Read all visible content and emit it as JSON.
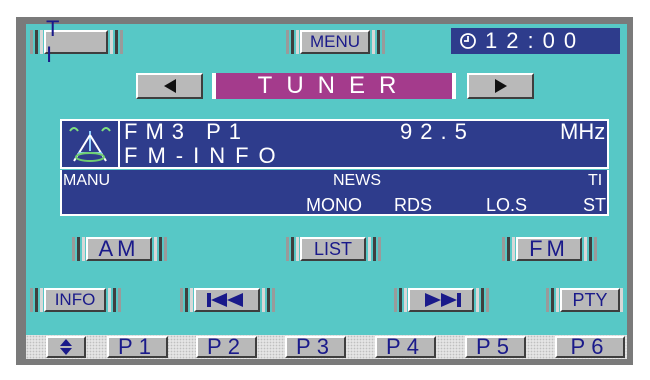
{
  "top_bar": {
    "ti_label": "T I",
    "menu_label": "MENU",
    "clock_time": "12:00"
  },
  "source": {
    "label": "TUNER"
  },
  "info": {
    "band_preset": "FM3   P1",
    "frequency": "92.5",
    "unit": "MHz",
    "station_name": "FM-INFO"
  },
  "indicators": {
    "manu": "MANU",
    "news": "NEWS",
    "ti": "TI",
    "mono": "MONO",
    "rds": "RDS",
    "los": "LO.S",
    "st": "ST"
  },
  "row_buttons": {
    "am": "AM",
    "list": "LIST",
    "fm": "FM",
    "info": "INFO",
    "pty": "PTY"
  },
  "presets": [
    "P1",
    "P2",
    "P3",
    "P4",
    "P5",
    "P6"
  ],
  "colors": {
    "screen_background": "#57c8c6",
    "display_panel": "#2e3c8c",
    "source_highlight": "#a43b8c",
    "button_face": "#b9b9b9",
    "button_text": "#1a1a8a"
  },
  "icons": {
    "clock": "clock-icon",
    "source_prev": "arrow-left-icon",
    "source_next": "arrow-right-icon",
    "antenna": "antenna-icon",
    "seek_back": "skip-back-icon",
    "seek_forward": "skip-forward-icon",
    "preset_scroll": "up-down-arrow-icon"
  }
}
